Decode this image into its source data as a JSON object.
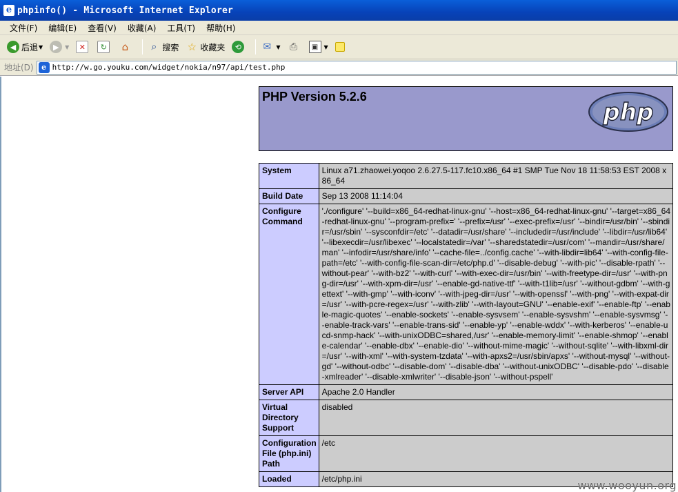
{
  "window": {
    "title": "phpinfo() - Microsoft Internet Explorer",
    "app_icon": "e"
  },
  "menu": [
    "文件(F)",
    "编辑(E)",
    "查看(V)",
    "收藏(A)",
    "工具(T)",
    "帮助(H)"
  ],
  "toolbar": {
    "back_label": "后退",
    "search_label": "搜索",
    "favorites_label": "收藏夹"
  },
  "address": {
    "label": "地址(D)",
    "url": "http://w.go.youku.com/widget/nokia/n97/api/test.php"
  },
  "php": {
    "version": "PHP Version 5.2.6",
    "logo_text": "php",
    "rows": [
      {
        "key": "System",
        "value": "Linux a71.zhaowei.yoqoo 2.6.27.5-117.fc10.x86_64 #1 SMP Tue Nov 18 11:58:53 EST 2008 x86_64"
      },
      {
        "key": "Build Date",
        "value": "Sep 13 2008 11:14:04"
      },
      {
        "key": "Configure Command",
        "value": "'./configure' '--build=x86_64-redhat-linux-gnu' '--host=x86_64-redhat-linux-gnu' '--target=x86_64-redhat-linux-gnu' '--program-prefix=' '--prefix=/usr' '--exec-prefix=/usr' '--bindir=/usr/bin' '--sbindir=/usr/sbin' '--sysconfdir=/etc' '--datadir=/usr/share' '--includedir=/usr/include' '--libdir=/usr/lib64' '--libexecdir=/usr/libexec' '--localstatedir=/var' '--sharedstatedir=/usr/com' '--mandir=/usr/share/man' '--infodir=/usr/share/info' '--cache-file=../config.cache' '--with-libdir=lib64' '--with-config-file-path=/etc' '--with-config-file-scan-dir=/etc/php.d' '--disable-debug' '--with-pic' '--disable-rpath' '--without-pear' '--with-bz2' '--with-curl' '--with-exec-dir=/usr/bin' '--with-freetype-dir=/usr' '--with-png-dir=/usr' '--with-xpm-dir=/usr' '--enable-gd-native-ttf' '--with-t1lib=/usr' '--without-gdbm' '--with-gettext' '--with-gmp' '--with-iconv' '--with-jpeg-dir=/usr' '--with-openssl' '--with-png' '--with-expat-dir=/usr' '--with-pcre-regex=/usr' '--with-zlib' '--with-layout=GNU' '--enable-exif' '--enable-ftp' '--enable-magic-quotes' '--enable-sockets' '--enable-sysvsem' '--enable-sysvshm' '--enable-sysvmsg' '--enable-track-vars' '--enable-trans-sid' '--enable-yp' '--enable-wddx' '--with-kerberos' '--enable-ucd-snmp-hack' '--with-unixODBC=shared,/usr' '--enable-memory-limit' '--enable-shmop' '--enable-calendar' '--enable-dbx' '--enable-dio' '--without-mime-magic' '--without-sqlite' '--with-libxml-dir=/usr' '--with-xml' '--with-system-tzdata' '--with-apxs2=/usr/sbin/apxs' '--without-mysql' '--without-gd' '--without-odbc' '--disable-dom' '--disable-dba' '--without-unixODBC' '--disable-pdo' '--disable-xmlreader' '--disable-xmlwriter' '--disable-json' '--without-pspell'"
      },
      {
        "key": "Server API",
        "value": "Apache 2.0 Handler"
      },
      {
        "key": "Virtual Directory Support",
        "value": "disabled"
      },
      {
        "key": "Configuration File (php.ini) Path",
        "value": "/etc"
      },
      {
        "key": "Loaded",
        "value": "/etc/php.ini"
      }
    ]
  },
  "watermark": "www.wooyun.org",
  "colors": {
    "php_header": "#9999cc",
    "key_cell": "#ccccff",
    "value_cell": "#cccccc"
  }
}
